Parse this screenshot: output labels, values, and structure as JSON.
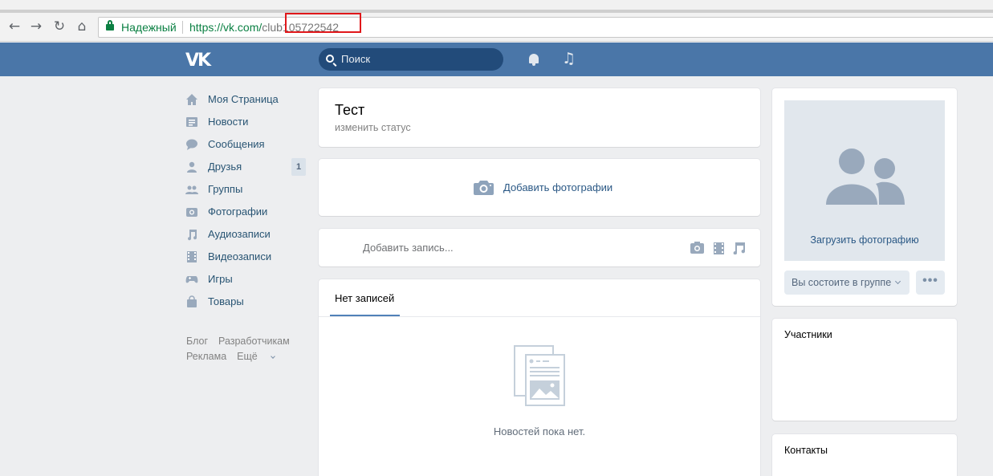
{
  "browser": {
    "nav": {
      "back": "←",
      "forward": "→",
      "reload": "↻",
      "home": "⌂"
    },
    "secure_label": "Надежный",
    "url_base": "https://vk.com/",
    "url_rest": "club105722542"
  },
  "header": {
    "logo": "VK",
    "search_placeholder": "Поиск"
  },
  "left_menu": {
    "items": [
      {
        "icon": "home-icon",
        "label": "Моя Страница"
      },
      {
        "icon": "news-icon",
        "label": "Новости"
      },
      {
        "icon": "messages-icon",
        "label": "Сообщения"
      },
      {
        "icon": "friend-icon",
        "label": "Друзья",
        "count": "1"
      },
      {
        "icon": "groups-icon",
        "label": "Группы"
      },
      {
        "icon": "camera-icon",
        "label": "Фотографии"
      },
      {
        "icon": "music-icon",
        "label": "Аудиозаписи"
      },
      {
        "icon": "film-icon",
        "label": "Видеозаписи"
      },
      {
        "icon": "gamepad-icon",
        "label": "Игры"
      },
      {
        "icon": "bag-icon",
        "label": "Товары"
      }
    ],
    "footer": [
      "Блог",
      "Разработчикам",
      "Реклама",
      "Ещё"
    ]
  },
  "main": {
    "title": "Тест",
    "status_link": "изменить статус",
    "add_photos": "Добавить фотографии",
    "post_placeholder": "Добавить запись...",
    "wall_tab": "Нет записей",
    "empty_text": "Новостей пока нет."
  },
  "right": {
    "upload_photo": "Загрузить фотографию",
    "member_button": "Вы состоите в группе",
    "more_button": "•••",
    "members_header": "Участники",
    "contacts_header": "Контакты"
  },
  "colors": {
    "header": "#4a76a8",
    "link": "#2a5885",
    "menu_link": "#285473",
    "background": "#edeef0",
    "secure": "#0b8043",
    "highlight": "#e0181b"
  }
}
